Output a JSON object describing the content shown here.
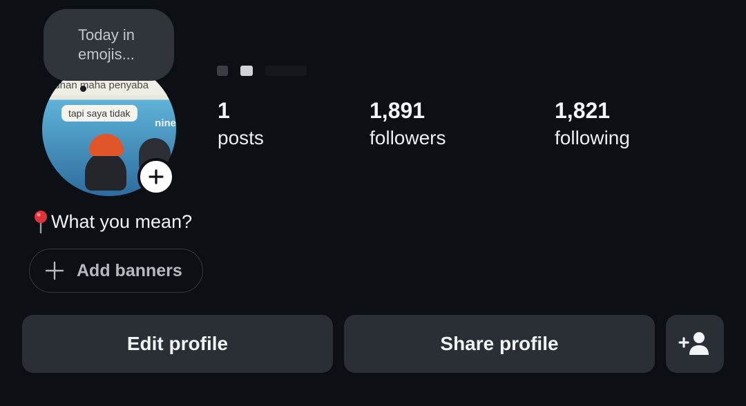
{
  "note": {
    "text_line1": "Today in",
    "text_line2": "emojis..."
  },
  "avatar": {
    "image_strip_text": "luhan maha penyaba",
    "image_bubble_text": "tapi saya tidak",
    "image_watermark": "nine",
    "add_icon": "plus-icon"
  },
  "stats": [
    {
      "value": "1",
      "label": "posts"
    },
    {
      "value": "1,891",
      "label": "followers"
    },
    {
      "value": "1,821",
      "label": "following"
    }
  ],
  "bio": {
    "icon": "pin-icon",
    "text": "What you mean?"
  },
  "banners": {
    "icon": "plus-icon",
    "label": "Add banners"
  },
  "actions": {
    "edit_label": "Edit profile",
    "share_label": "Share profile",
    "add_person_icon": "add-person-icon"
  },
  "colors": {
    "background": "#0c0f14",
    "button": "#2a2e35",
    "note_bubble": "#30343b",
    "pin_red": "#e0323a"
  }
}
